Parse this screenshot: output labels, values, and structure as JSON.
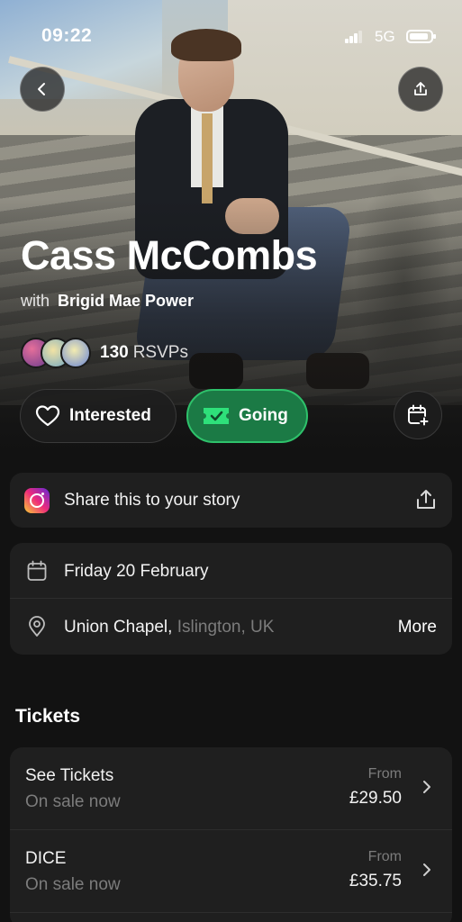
{
  "status_bar": {
    "time": "09:22",
    "network": "5G"
  },
  "event": {
    "title": "Cass McCombs",
    "support_prefix": "with",
    "support_act": "Brigid Mae Power",
    "rsvp_count": "130",
    "rsvp_label": "RSVPs"
  },
  "actions": {
    "interested_label": "Interested",
    "going_label": "Going"
  },
  "story": {
    "label": "Share this to your story"
  },
  "details": {
    "date": "Friday 20 February",
    "venue": "Union Chapel,",
    "location": "Islington, UK",
    "more_label": "More"
  },
  "tickets": {
    "section_title": "Tickets",
    "items": [
      {
        "name": "See Tickets",
        "status": "On sale now",
        "from_label": "From",
        "price": "£29.50"
      },
      {
        "name": "DICE",
        "status": "On sale now",
        "from_label": "From",
        "price": "£35.75"
      }
    ]
  },
  "colors": {
    "background": "#121212",
    "card": "#1f1f1f",
    "going_green": "#1b7a45",
    "going_border": "#2ec26b",
    "muted_text": "#7c7c7c"
  },
  "icons": {
    "back": "chevron-left-icon",
    "share": "share-icon",
    "interested": "heart-icon",
    "going": "ticket-check-icon",
    "calendar_add": "calendar-plus-icon",
    "instagram": "instagram-icon",
    "date": "calendar-icon",
    "location": "map-pin-icon",
    "chevron": "chevron-right-icon"
  }
}
